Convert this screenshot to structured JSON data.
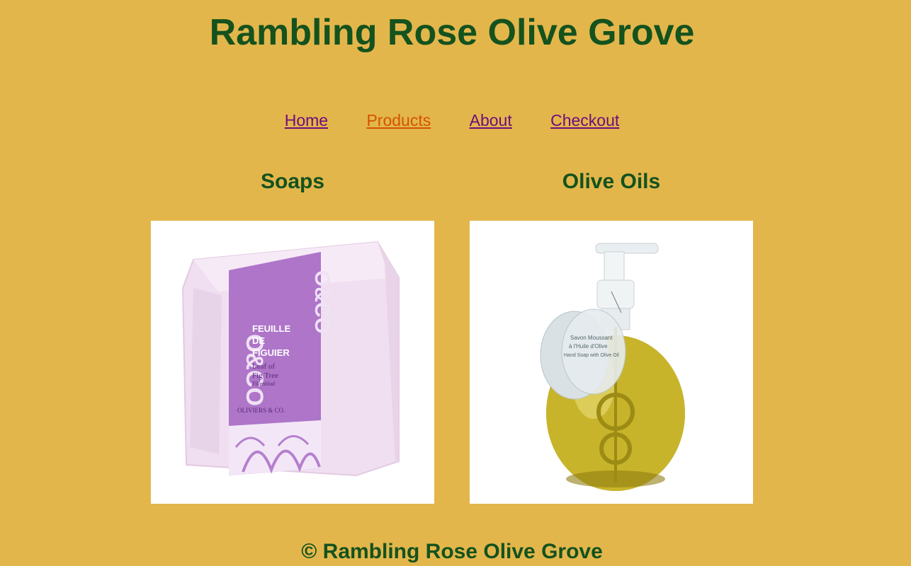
{
  "header": {
    "title": "Rambling Rose Olive Grove"
  },
  "nav": {
    "items": [
      {
        "label": "Home",
        "active": false
      },
      {
        "label": "Products",
        "active": true
      },
      {
        "label": "About",
        "active": false
      },
      {
        "label": "Checkout",
        "active": false
      }
    ]
  },
  "products": [
    {
      "name": "Soaps",
      "image": {
        "brand_mark": "O&CO",
        "label_title_1": "FEUILLE",
        "label_title_2": "DE",
        "label_title_3": "FIGUIER",
        "label_sub_1": "Leaf of",
        "label_sub_2": "Fig Tree",
        "label_sub_3": "Fikenblad",
        "maker": "OLIVIERS & CO."
      }
    },
    {
      "name": "Olive Oils",
      "image": {
        "tag_line_1": "Savon Moussant",
        "tag_line_2": "à l'Huile d'Olive",
        "tag_line_3": "Hand Soap with Olive Oil"
      }
    }
  ],
  "footer": {
    "text": "© Rambling Rose Olive Grove"
  },
  "colors": {
    "background": "#e3b64b",
    "heading": "#14521e",
    "link": "#6d0c7c",
    "active_link": "#d35400"
  }
}
